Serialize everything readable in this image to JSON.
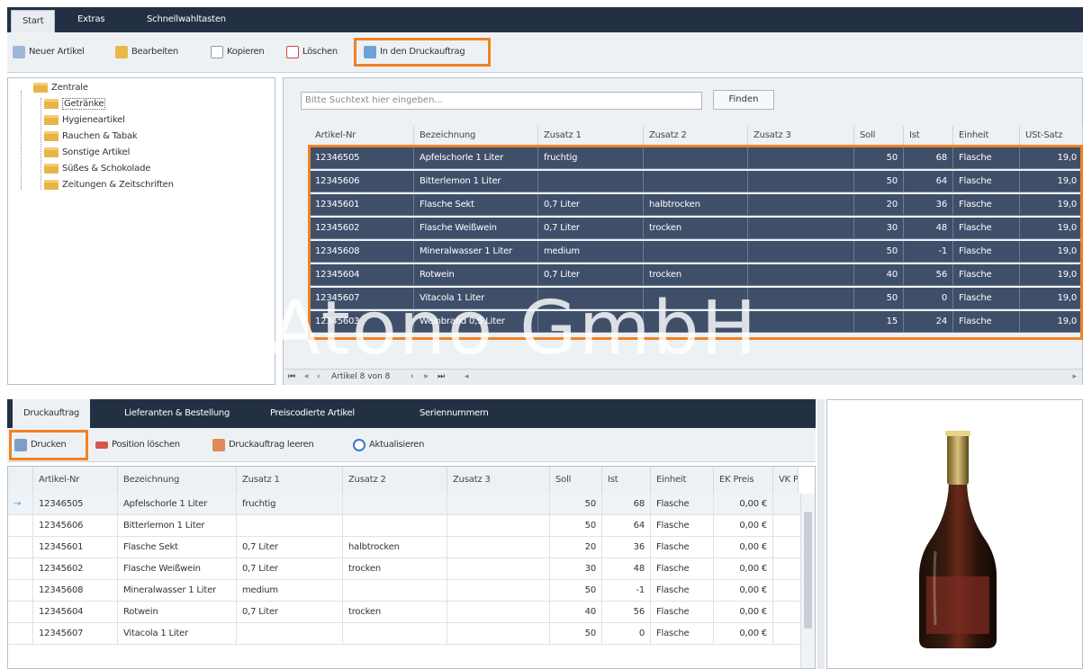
{
  "ribbon": {
    "tabs": [
      "Start",
      "Extras",
      "Schnellwahltasten"
    ],
    "buttons": [
      "Neuer Artikel",
      "Bearbeiten",
      "Kopieren",
      "Löschen",
      "In den Druckauftrag"
    ]
  },
  "tree": {
    "root": "Zentrale",
    "items": [
      "Getränke",
      "Hygieneartikel",
      "Rauchen & Tabak",
      "Sonstige Artikel",
      "Süßes & Schokolade",
      "Zeitungen & Zeitschriften"
    ]
  },
  "search": {
    "placeholder": "Bitte Suchtext hier eingeben...",
    "button": "Finden"
  },
  "grid": {
    "columns": [
      "Artikel-Nr",
      "Bezeichnung",
      "Zusatz 1",
      "Zusatz 2",
      "Zusatz 3",
      "Soll",
      "Ist",
      "Einheit",
      "USt-Satz"
    ],
    "rows": [
      [
        "12346505",
        "Apfelschorle 1 Liter",
        "fruchtig",
        "",
        "",
        "50",
        "68",
        "Flasche",
        "19,0"
      ],
      [
        "12345606",
        "Bitterlemon 1 Liter",
        "",
        "",
        "",
        "50",
        "64",
        "Flasche",
        "19,0"
      ],
      [
        "12345601",
        "Flasche Sekt",
        "0,7 Liter",
        "halbtrocken",
        "",
        "20",
        "36",
        "Flasche",
        "19,0"
      ],
      [
        "12345602",
        "Flasche Weißwein",
        "0,7 Liter",
        "trocken",
        "",
        "30",
        "48",
        "Flasche",
        "19,0"
      ],
      [
        "12345608",
        "Mineralwasser 1 Liter",
        "medium",
        "",
        "",
        "50",
        "-1",
        "Flasche",
        "19,0"
      ],
      [
        "12345604",
        "Rotwein",
        "0,7 Liter",
        "trocken",
        "",
        "40",
        "56",
        "Flasche",
        "19,0"
      ],
      [
        "12345607",
        "Vitacola 1 Liter",
        "",
        "",
        "",
        "50",
        "0",
        "Flasche",
        "19,0"
      ],
      [
        "12345603",
        "Weinbrand 0,5 Liter",
        "",
        "",
        "",
        "15",
        "24",
        "Flasche",
        "19,0"
      ]
    ],
    "navigator": "Artikel 8 von 8"
  },
  "watermark": "Atono GmbH",
  "lower_tabs": [
    "Druckauftrag",
    "Lieferanten & Bestellung",
    "Preiscodierte Artikel",
    "Seriennummern"
  ],
  "lower_toolbar": [
    "Drucken",
    "Position löschen",
    "Druckauftrag leeren",
    "Aktualisieren"
  ],
  "print_grid": {
    "columns": [
      "Artikel-Nr",
      "Bezeichnung",
      "Zusatz 1",
      "Zusatz 2",
      "Zusatz 3",
      "Soll",
      "Ist",
      "Einheit",
      "EK Preis",
      "VK Pr"
    ],
    "rows": [
      [
        "12346505",
        "Apfelschorle 1 Liter",
        "fruchtig",
        "",
        "",
        "50",
        "68",
        "Flasche",
        "0,00 €"
      ],
      [
        "12345606",
        "Bitterlemon 1 Liter",
        "",
        "",
        "",
        "50",
        "64",
        "Flasche",
        "0,00 €"
      ],
      [
        "12345601",
        "Flasche Sekt",
        "0,7 Liter",
        "halbtrocken",
        "",
        "20",
        "36",
        "Flasche",
        "0,00 €"
      ],
      [
        "12345602",
        "Flasche Weißwein",
        "0,7 Liter",
        "trocken",
        "",
        "30",
        "48",
        "Flasche",
        "0,00 €"
      ],
      [
        "12345608",
        "Mineralwasser 1 Liter",
        "medium",
        "",
        "",
        "50",
        "-1",
        "Flasche",
        "0,00 €"
      ],
      [
        "12345604",
        "Rotwein",
        "0,7 Liter",
        "trocken",
        "",
        "40",
        "56",
        "Flasche",
        "0,00 €"
      ],
      [
        "12345607",
        "Vitacola 1 Liter",
        "",
        "",
        "",
        "50",
        "0",
        "Flasche",
        "0,00 €"
      ]
    ]
  },
  "colors": {
    "accent": "#f08224",
    "header": "#233044",
    "selection": "#3f4f6a"
  },
  "icons": [
    "new-article-icon",
    "edit-icon",
    "copy-icon",
    "delete-icon",
    "print-job-icon",
    "folder-icon",
    "printer-icon",
    "refresh-icon",
    "wine-bottle-image"
  ]
}
